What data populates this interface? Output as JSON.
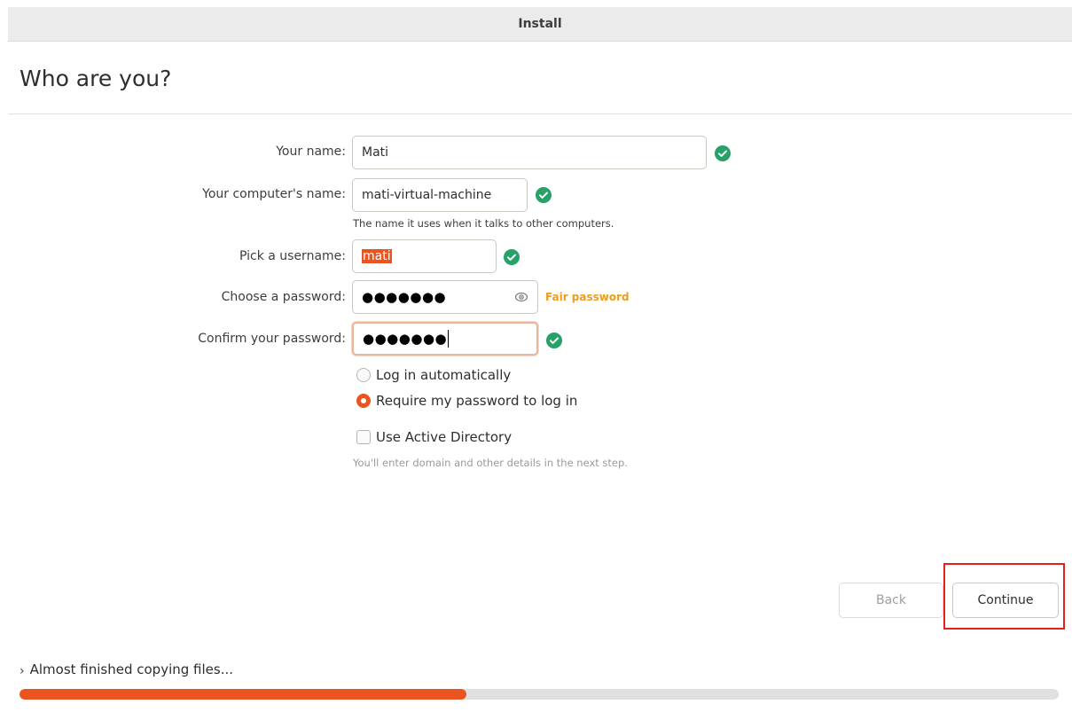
{
  "window": {
    "title": "Install"
  },
  "page": {
    "title": "Who are you?"
  },
  "form": {
    "name": {
      "label": "Your name:",
      "value": "Mati"
    },
    "computer_name": {
      "label": "Your computer's name:",
      "value": "mati-virtual-machine",
      "hint": "The name it uses when it talks to other computers."
    },
    "username": {
      "label": "Pick a username:",
      "value": "mati"
    },
    "password": {
      "label": "Choose a password:",
      "masked": "●●●●●●●",
      "strength": "Fair password"
    },
    "confirm_password": {
      "label": "Confirm your password:",
      "masked": "●●●●●●●"
    },
    "login_options": [
      {
        "label": "Log in automatically",
        "selected": false
      },
      {
        "label": "Require my password to log in",
        "selected": true
      }
    ],
    "active_directory": {
      "label": "Use Active Directory",
      "checked": false,
      "hint": "You'll enter domain and other details in the next step."
    }
  },
  "buttons": {
    "back": "Back",
    "continue": "Continue"
  },
  "status": {
    "text": "Almost finished copying files...",
    "progress": 0.43
  },
  "colors": {
    "accent": "#e95420",
    "success": "#26a269",
    "warning": "#f09c1a"
  },
  "icons": {
    "valid": "check-circle-icon",
    "reveal": "eye-icon",
    "expand": "chevron-right-icon"
  }
}
